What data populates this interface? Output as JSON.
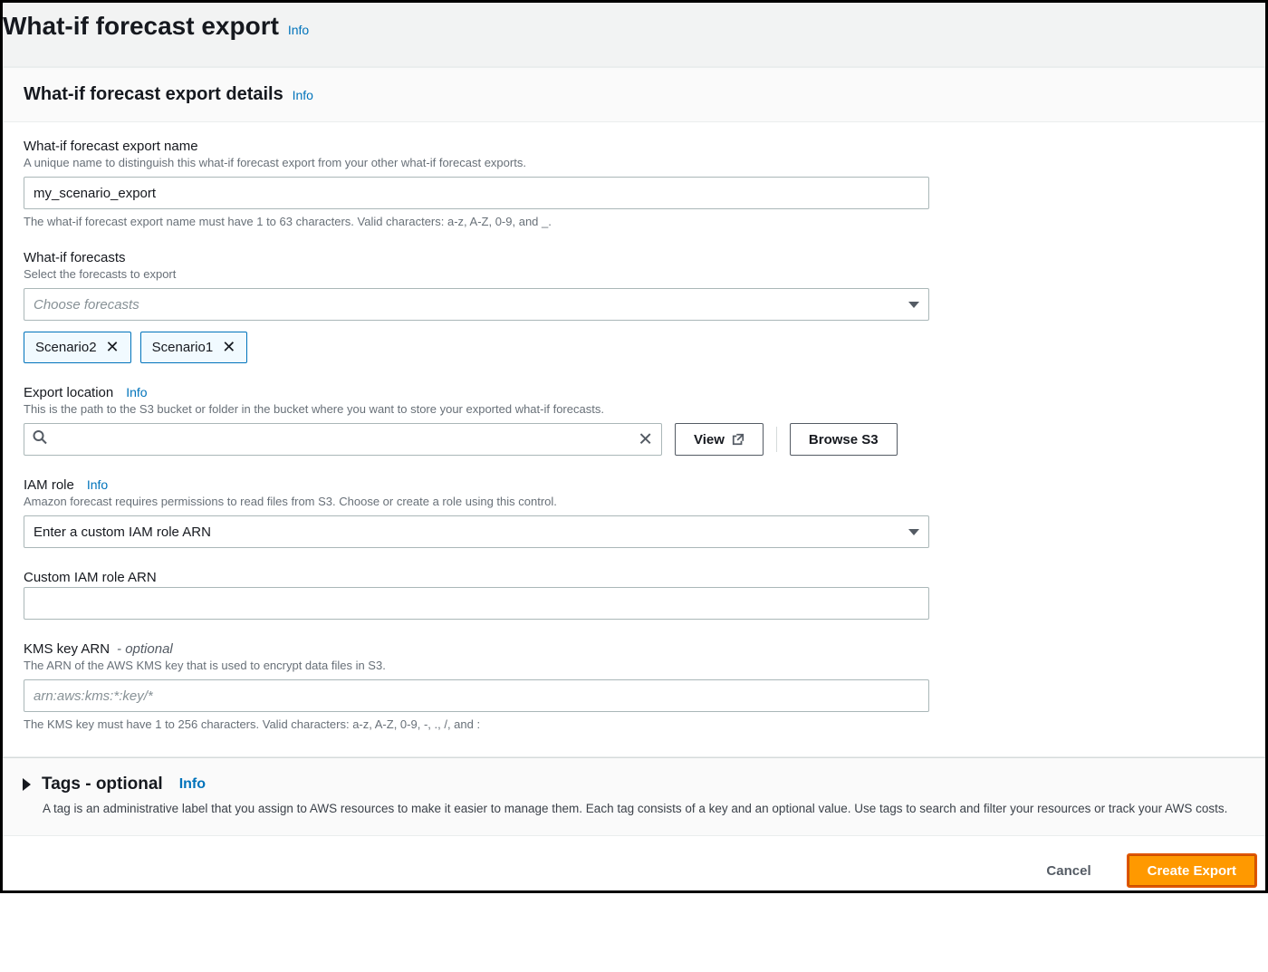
{
  "header": {
    "title": "What-if forecast export",
    "info": "Info"
  },
  "details": {
    "title": "What-if forecast export details",
    "info": "Info",
    "name": {
      "label": "What-if forecast export name",
      "desc": "A unique name to distinguish this what-if forecast export from your other what-if forecast exports.",
      "value": "my_scenario_export",
      "hint": "The what-if forecast export name must have 1 to 63 characters. Valid characters: a-z, A-Z, 0-9, and _."
    },
    "forecasts": {
      "label": "What-if forecasts",
      "desc": "Select the forecasts to export",
      "placeholder": "Choose forecasts",
      "tokens": [
        "Scenario2",
        "Scenario1"
      ]
    },
    "export_location": {
      "label": "Export location",
      "info": "Info",
      "desc": "This is the path to the S3 bucket or folder in the bucket where you want to store your exported what-if forecasts.",
      "view": "View",
      "browse": "Browse S3"
    },
    "iam_role": {
      "label": "IAM role",
      "info": "Info",
      "desc": "Amazon forecast requires permissions to read files from S3. Choose or create a role using this control.",
      "selected": "Enter a custom IAM role ARN"
    },
    "custom_arn": {
      "label": "Custom IAM role ARN"
    },
    "kms": {
      "label": "KMS key ARN",
      "optional": "- optional",
      "desc": "The ARN of the AWS KMS key that is used to encrypt data files in S3.",
      "placeholder": "arn:aws:kms:*:key/*",
      "hint": "The KMS key must have 1 to 256 characters. Valid characters: a-z, A-Z, 0-9, -, ., /, and :"
    }
  },
  "tags": {
    "title": "Tags - optional",
    "info": "Info",
    "desc": "A tag is an administrative label that you assign to AWS resources to make it easier to manage them. Each tag consists of a key and an optional value. Use tags to search and filter your resources or track your AWS costs."
  },
  "footer": {
    "cancel": "Cancel",
    "create": "Create Export"
  }
}
